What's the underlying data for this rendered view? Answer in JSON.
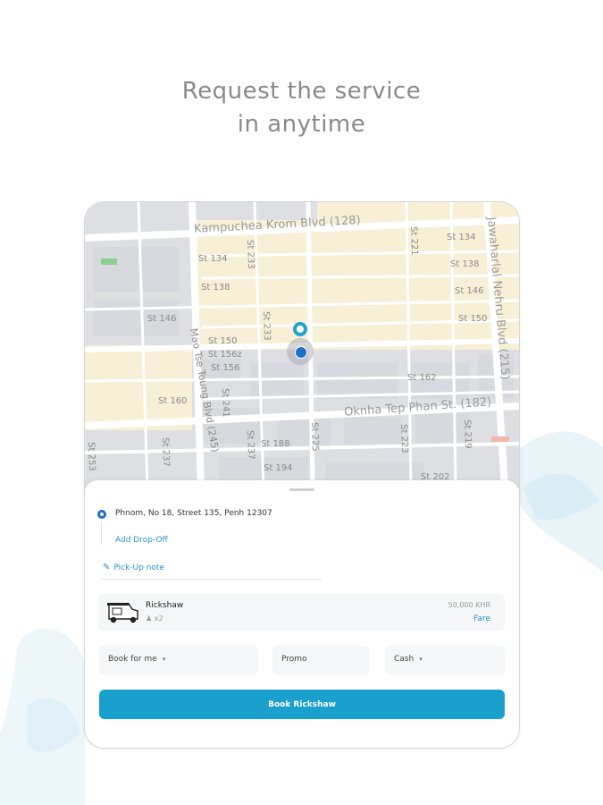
{
  "headline": {
    "line1": "Request the service",
    "line2": "in anytime"
  },
  "map": {
    "labels": {
      "kampuchea": "Kampuchea Krom Blvd (128)",
      "jawaharlal": "Jawaharlal Nehru Blvd (215)",
      "oknha": "Oknha Tep Phan St. (182)",
      "mao": "Mao Tse Toung Blvd (245)",
      "st134a": "St 134",
      "st134b": "St 134",
      "st138a": "St 138",
      "st138b": "St 138",
      "st146a": "St 146",
      "st146b": "St 146",
      "st150a": "St 150",
      "st150b": "St 150",
      "st156z": "St 156z",
      "st156": "St 156",
      "st160": "St 160",
      "st162": "St 162",
      "st188": "St 188",
      "st194": "St 194",
      "st202": "St 202",
      "st233a": "St 233",
      "st233b": "St 233",
      "st221": "St 221",
      "st241": "St 241",
      "st237a": "St 237",
      "st237b": "St 237",
      "st225": "St 225",
      "st223": "St 223",
      "st219": "St 219",
      "st253": "St 253"
    }
  },
  "trip": {
    "pickup": "Phnom, No 18, Street 135, Penh 12307",
    "dropoff_label": "Add Drop-Off",
    "note_label": "Pick-Up note"
  },
  "vehicle": {
    "name": "Rickshaw",
    "seats": "x2",
    "price": "50,000 KHR",
    "fare_label": "Fare"
  },
  "options": {
    "book_for": "Book for me",
    "promo": "Promo",
    "payment": "Cash"
  },
  "book_button": "Book Rickshaw",
  "colors": {
    "accent": "#1aa0cd",
    "link": "#2a8fd0",
    "pin": "#22a2cf"
  }
}
